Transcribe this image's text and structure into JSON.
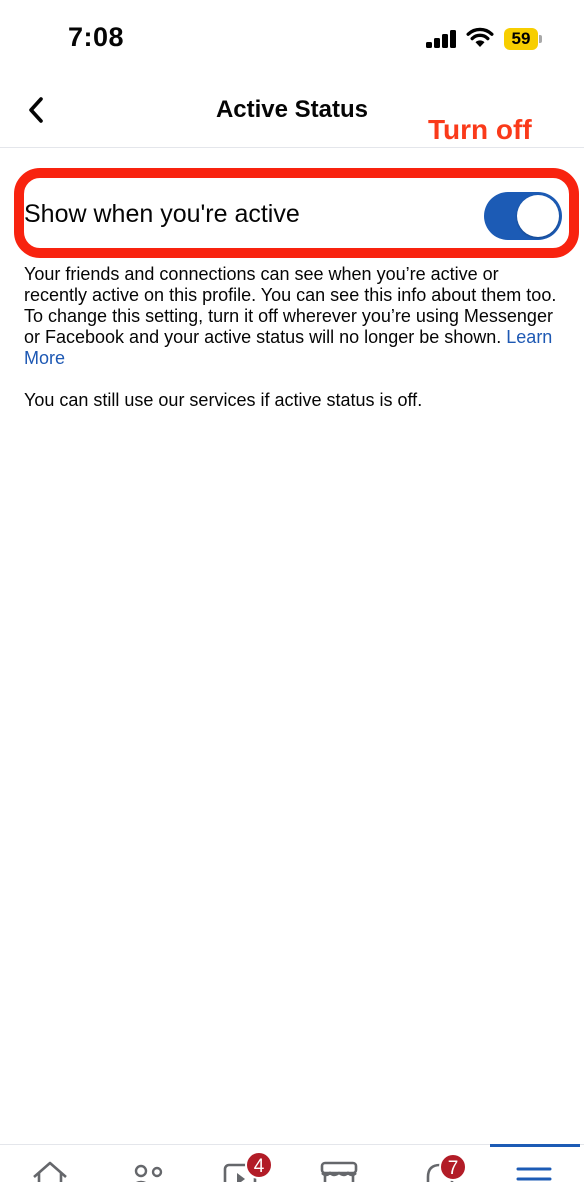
{
  "status_bar": {
    "time": "7:08",
    "battery_level": "59",
    "battery_color": "#f7ce00"
  },
  "header": {
    "title": "Active Status"
  },
  "annotation": {
    "text": "Turn off",
    "color": "#fa3a1a"
  },
  "setting": {
    "label": "Show when you're active",
    "toggle_state": "on",
    "toggle_color": "#1c5bb5"
  },
  "description": {
    "text": "Your friends and connections can see when you’re active or recently active on this profile. You can see this info about them too. To change this setting, turn it off wherever you’re using Messenger or Facebook and your active status will no longer be shown.",
    "learn_more": "Learn More",
    "note": "You can still use our services if active status is off."
  },
  "tab_bar": {
    "tabs": [
      {
        "icon": "home-icon"
      },
      {
        "icon": "friends-icon"
      },
      {
        "icon": "video-icon",
        "badge": "4"
      },
      {
        "icon": "marketplace-icon"
      },
      {
        "icon": "notifications-icon",
        "badge": "7"
      },
      {
        "icon": "menu-icon",
        "active": true
      }
    ]
  }
}
